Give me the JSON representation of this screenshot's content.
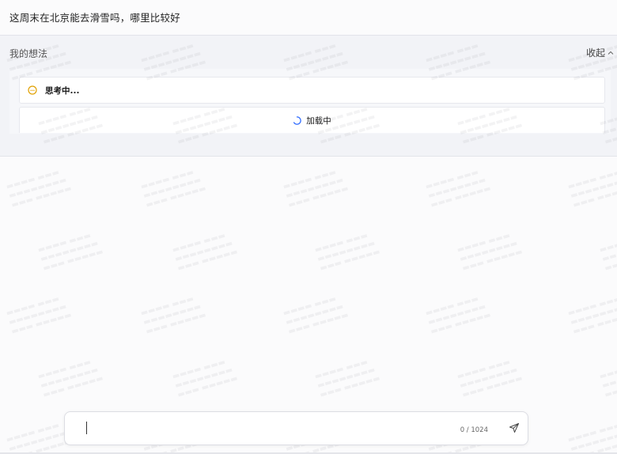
{
  "conversation": {
    "user_question": "这周末在北京能去滑雪吗，哪里比较好"
  },
  "thoughts": {
    "title": "我的想法",
    "collapse_label": "收起",
    "thinking_status": "思考中...",
    "loading_label": "加载中"
  },
  "composer": {
    "counter": "0 / 1024"
  },
  "colors": {
    "thinking_icon": "#e0a000",
    "spinner": "#2f6bff",
    "panel_bg": "#f2f3f7"
  },
  "icons": {
    "collapse": "chevron-up-icon",
    "thinking": "thinking-dots-icon",
    "loading": "spinner-icon",
    "send": "send-icon"
  }
}
